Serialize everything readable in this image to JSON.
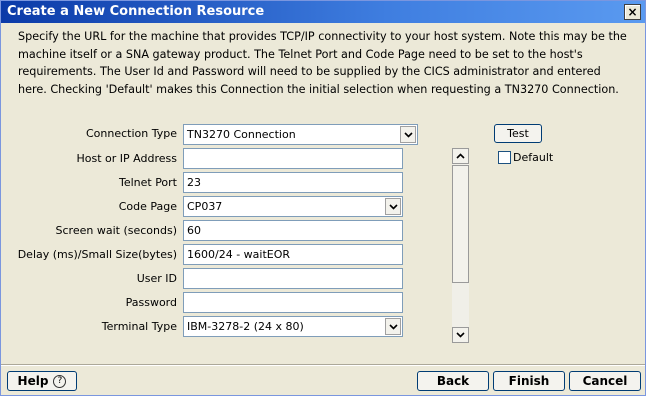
{
  "window": {
    "title": "Create a New Connection Resource",
    "close_glyph": "×"
  },
  "description": "Specify the URL for the machine that provides TCP/IP connectivity to your host system.  Note this may be the machine itself or a SNA gateway product. The Telnet Port and Code Page need to be set to the host's requirements. The User Id and Password will need to be supplied by the CICS administrator and entered here. Checking 'Default' makes this Connection the initial selection when requesting a TN3270 Connection.",
  "form": {
    "connection_type": {
      "label": "Connection Type",
      "value": "TN3270 Connection"
    },
    "host": {
      "label": "Host or IP Address",
      "value": ""
    },
    "telnet_port": {
      "label": "Telnet Port",
      "value": "23"
    },
    "code_page": {
      "label": "Code Page",
      "value": "CP037"
    },
    "screen_wait": {
      "label": "Screen wait (seconds)",
      "value": "60"
    },
    "delay": {
      "label": "Delay (ms)/Small Size(bytes)",
      "value": "1600/24 - waitEOR"
    },
    "user_id": {
      "label": "User ID",
      "value": ""
    },
    "password": {
      "label": "Password",
      "value": ""
    },
    "terminal_type": {
      "label": "Terminal Type",
      "value": "IBM-3278-2 (24 x 80)"
    }
  },
  "side": {
    "test_label": "Test",
    "default_label": "Default",
    "default_checked": false
  },
  "footer": {
    "help_label": "Help",
    "help_glyph": "?",
    "back_label": "Back",
    "finish_label": "Finish",
    "cancel_label": "Cancel"
  }
}
